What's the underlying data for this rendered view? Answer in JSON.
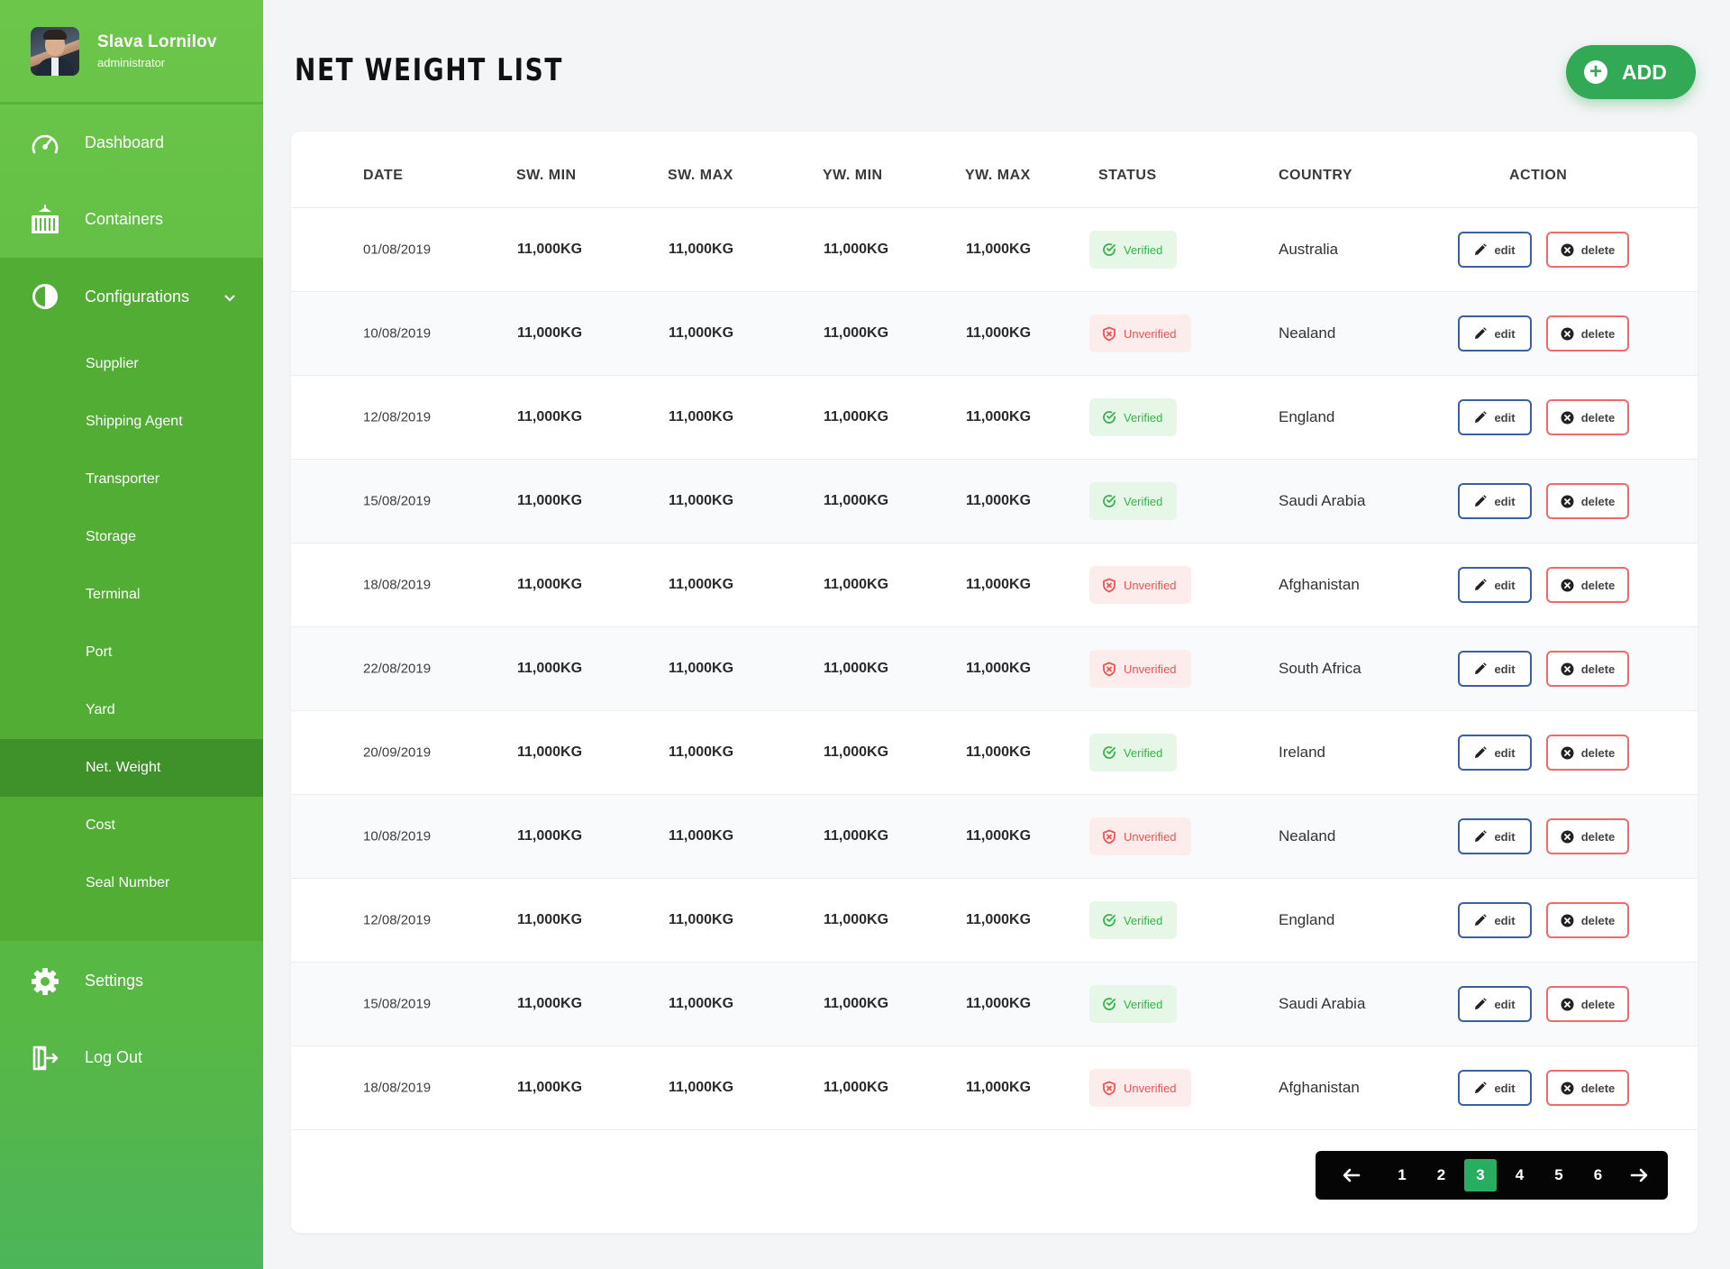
{
  "user": {
    "name": "Slava Lornilov",
    "role": "administrator"
  },
  "nav": {
    "dashboard": "Dashboard",
    "containers": "Containers",
    "configurations": "Configurations",
    "settings": "Settings",
    "logout": "Log Out"
  },
  "config_items": [
    "Supplier",
    "Shipping Agent",
    "Transporter",
    "Storage",
    "Terminal",
    "Port",
    "Yard",
    "Net. Weight",
    "Cost",
    "Seal Number"
  ],
  "active_config_item": "Net. Weight",
  "page": {
    "title": "NET WEIGHT LIST",
    "add_label": "ADD"
  },
  "columns": {
    "date": "DATE",
    "sw_min": "SW. MIN",
    "sw_max": "SW. MAX",
    "yw_min": "YW. MIN",
    "yw_max": "YW. MAX",
    "status": "STATUS",
    "country": "COUNTRY",
    "action": "ACTION"
  },
  "rows": [
    {
      "date": "01/08/2019",
      "sw_min": "11,000KG",
      "sw_max": "11,000KG",
      "yw_min": "11,000KG",
      "yw_max": "11,000KG",
      "status": "Verified",
      "country": "Australia"
    },
    {
      "date": "10/08/2019",
      "sw_min": "11,000KG",
      "sw_max": "11,000KG",
      "yw_min": "11,000KG",
      "yw_max": "11,000KG",
      "status": "Unverified",
      "country": "Nealand"
    },
    {
      "date": "12/08/2019",
      "sw_min": "11,000KG",
      "sw_max": "11,000KG",
      "yw_min": "11,000KG",
      "yw_max": "11,000KG",
      "status": "Verified",
      "country": "England"
    },
    {
      "date": "15/08/2019",
      "sw_min": "11,000KG",
      "sw_max": "11,000KG",
      "yw_min": "11,000KG",
      "yw_max": "11,000KG",
      "status": "Verified",
      "country": "Saudi Arabia"
    },
    {
      "date": "18/08/2019",
      "sw_min": "11,000KG",
      "sw_max": "11,000KG",
      "yw_min": "11,000KG",
      "yw_max": "11,000KG",
      "status": "Unverified",
      "country": "Afghanistan"
    },
    {
      "date": "22/08/2019",
      "sw_min": "11,000KG",
      "sw_max": "11,000KG",
      "yw_min": "11,000KG",
      "yw_max": "11,000KG",
      "status": "Unverified",
      "country": "South Africa"
    },
    {
      "date": "20/09/2019",
      "sw_min": "11,000KG",
      "sw_max": "11,000KG",
      "yw_min": "11,000KG",
      "yw_max": "11,000KG",
      "status": "Verified",
      "country": "Ireland"
    },
    {
      "date": "10/08/2019",
      "sw_min": "11,000KG",
      "sw_max": "11,000KG",
      "yw_min": "11,000KG",
      "yw_max": "11,000KG",
      "status": "Unverified",
      "country": "Nealand"
    },
    {
      "date": "12/08/2019",
      "sw_min": "11,000KG",
      "sw_max": "11,000KG",
      "yw_min": "11,000KG",
      "yw_max": "11,000KG",
      "status": "Verified",
      "country": "England"
    },
    {
      "date": "15/08/2019",
      "sw_min": "11,000KG",
      "sw_max": "11,000KG",
      "yw_min": "11,000KG",
      "yw_max": "11,000KG",
      "status": "Verified",
      "country": "Saudi Arabia"
    },
    {
      "date": "18/08/2019",
      "sw_min": "11,000KG",
      "sw_max": "11,000KG",
      "yw_min": "11,000KG",
      "yw_max": "11,000KG",
      "status": "Unverified",
      "country": "Afghanistan"
    }
  ],
  "actions": {
    "edit": "edit",
    "delete": "delete"
  },
  "pagination": {
    "pages": [
      "1",
      "2",
      "3",
      "4",
      "5",
      "6"
    ],
    "current": "3",
    "prev": "←",
    "next": "→"
  },
  "colors": {
    "sidebar_green": "#5cbb41",
    "active_item": "#3f912a",
    "add_button": "#31a955",
    "verified": "#37b24d",
    "unverified": "#ef5350",
    "edit_border": "#3a5fa3",
    "delete_border": "#ef6a6a"
  },
  "icons": {
    "dashboard": "speedometer-icon",
    "containers": "container-icon",
    "configurations": "half-circle-icon",
    "settings": "gear-icon",
    "logout": "logout-icon",
    "verified": "check-circle-icon",
    "unverified": "shield-x-icon",
    "edit": "pencil-icon",
    "delete": "x-circle-icon"
  }
}
